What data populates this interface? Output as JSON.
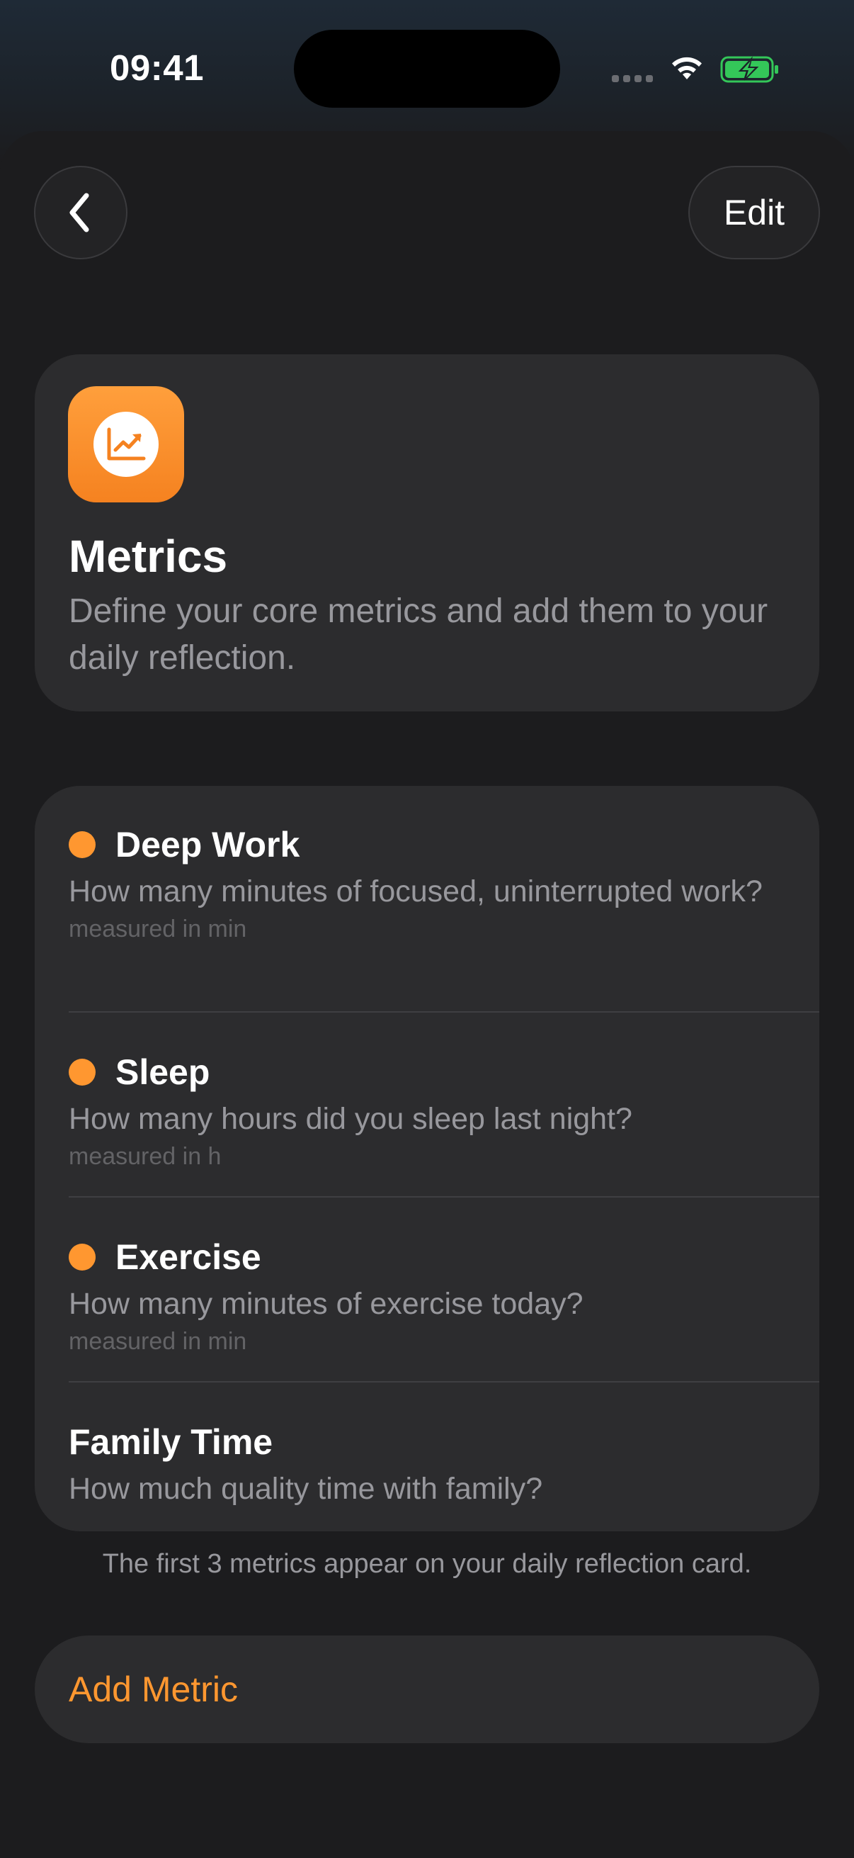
{
  "status_bar": {
    "time": "09:41"
  },
  "nav": {
    "edit_label": "Edit"
  },
  "header": {
    "title": "Metrics",
    "description": "Define your core metrics and add them to your daily reflection.",
    "icon": "chart-line-up-icon"
  },
  "metrics": [
    {
      "title": "Deep Work",
      "question": "How many minutes of focused, uninterrupted work?",
      "unit": "measured in min",
      "on_card": true
    },
    {
      "title": "Sleep",
      "question": "How many hours did you sleep last night?",
      "unit": "measured in h",
      "on_card": true
    },
    {
      "title": "Exercise",
      "question": "How many minutes of exercise today?",
      "unit": "measured in min",
      "on_card": true
    },
    {
      "title": "Family Time",
      "question": "How much quality time with family?",
      "on_card": false
    }
  ],
  "footnote": "The first 3 metrics appear on your daily reflection card.",
  "add_metric_label": "Add Metric",
  "colors": {
    "accent": "#ff9730",
    "card": "#2c2c2e",
    "background": "#1c1c1e",
    "battery": "#34c759"
  }
}
